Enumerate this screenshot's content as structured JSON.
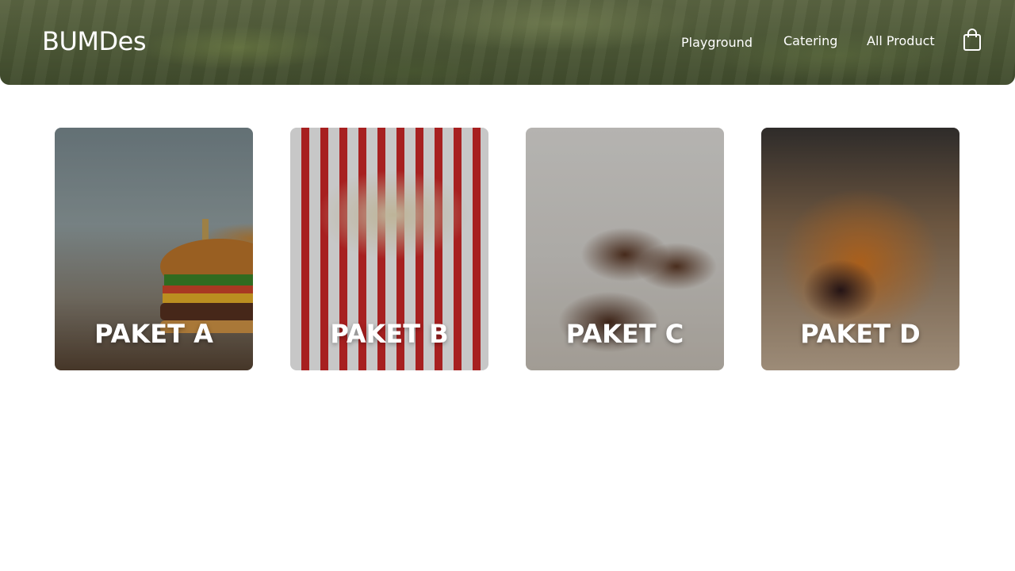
{
  "header": {
    "brand": "BUMDes",
    "nav": [
      "Playground",
      "Catering",
      "All Product"
    ],
    "cart_icon": "shopping-bag-icon"
  },
  "products": [
    {
      "label": "PAKET A"
    },
    {
      "label": "PAKET B"
    },
    {
      "label": "PAKET C"
    },
    {
      "label": "PAKET D"
    }
  ]
}
